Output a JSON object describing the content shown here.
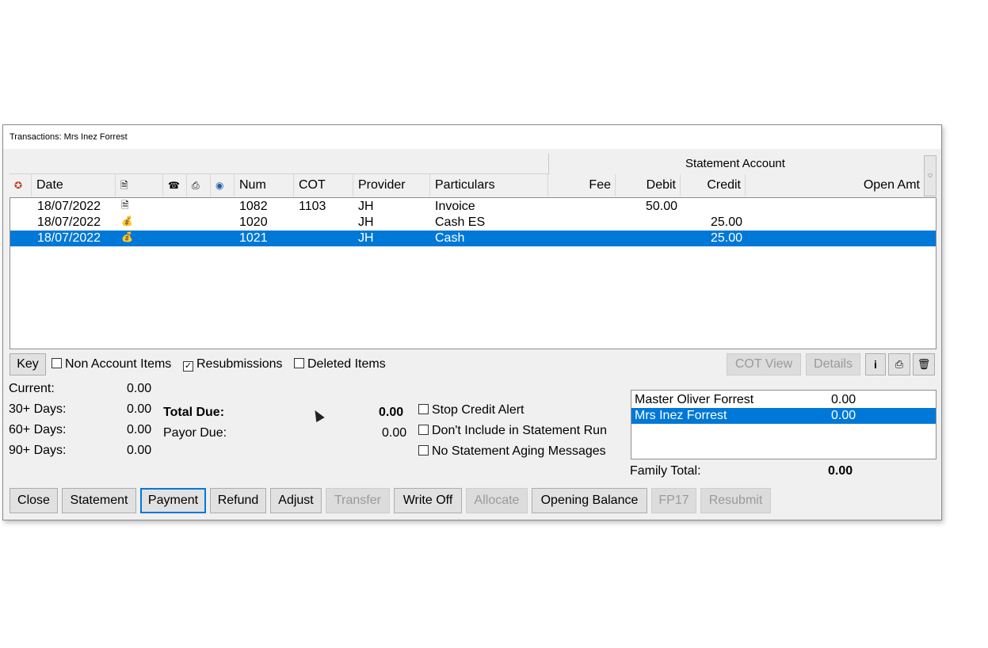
{
  "window": {
    "title": "Transactions: Mrs Inez Forrest"
  },
  "group_header": "Statement Account",
  "columns": {
    "status_icon": "status-icon",
    "date": "Date",
    "doc_icon": "document-icon",
    "phone_icon": "phone-icon",
    "printer_icon": "printer-icon",
    "web_icon": "web-icon",
    "num": "Num",
    "cot": "COT",
    "provider": "Provider",
    "particulars": "Particulars",
    "fee": "Fee",
    "debit": "Debit",
    "credit": "Credit",
    "open_amt": "Open Amt"
  },
  "rows": [
    {
      "date": "18/07/2022",
      "icon": "document-icon",
      "num": "1082",
      "cot": "1103",
      "provider": "JH",
      "particulars": "Invoice",
      "fee": "",
      "debit": "50.00",
      "credit": "",
      "open": ""
    },
    {
      "date": "18/07/2022",
      "icon": "cash-icon",
      "num": "1020",
      "cot": "",
      "provider": "JH",
      "particulars": "Cash ES",
      "fee": "",
      "debit": "",
      "credit": "25.00",
      "open": ""
    },
    {
      "date": "18/07/2022",
      "icon": "cash-icon",
      "num": "1021",
      "cot": "",
      "provider": "JH",
      "particulars": "Cash",
      "fee": "",
      "debit": "",
      "credit": "25.00",
      "open": "",
      "selected": true
    }
  ],
  "filters": {
    "key_label": "Key",
    "non_account": {
      "label": "Non Account Items",
      "checked": false
    },
    "resubmissions": {
      "label": "Resubmissions",
      "checked": true
    },
    "deleted": {
      "label": "Deleted Items",
      "checked": false
    }
  },
  "side_buttons": {
    "cot_view": "COT View",
    "details": "Details",
    "info": "i"
  },
  "aging": {
    "current_label": "Current:",
    "current": "0.00",
    "d30_label": "30+ Days:",
    "d30": "0.00",
    "d60_label": "60+ Days:",
    "d60": "0.00",
    "d90_label": "90+ Days:",
    "d90": "0.00"
  },
  "totals": {
    "total_due_label": "Total Due:",
    "total_due": "0.00",
    "payor_due_label": "Payor Due:",
    "payor_due": "0.00"
  },
  "options": {
    "stop_credit": "Stop Credit Alert",
    "dont_include": "Don't Include in Statement Run",
    "no_aging": "No Statement Aging Messages"
  },
  "family": {
    "members": [
      {
        "name": "Master Oliver Forrest",
        "amount": "0.00"
      },
      {
        "name": "Mrs Inez Forrest",
        "amount": "0.00",
        "selected": true
      }
    ],
    "total_label": "Family Total:",
    "total": "0.00"
  },
  "buttons": {
    "close": "Close",
    "statement": "Statement",
    "payment": "Payment",
    "refund": "Refund",
    "adjust": "Adjust",
    "transfer": "Transfer",
    "write_off": "Write Off",
    "allocate": "Allocate",
    "opening_balance": "Opening Balance",
    "fp17": "FP17",
    "resubmit": "Resubmit"
  },
  "colors": {
    "selection": "#0078d7",
    "window_bg": "#f0f0f0"
  }
}
